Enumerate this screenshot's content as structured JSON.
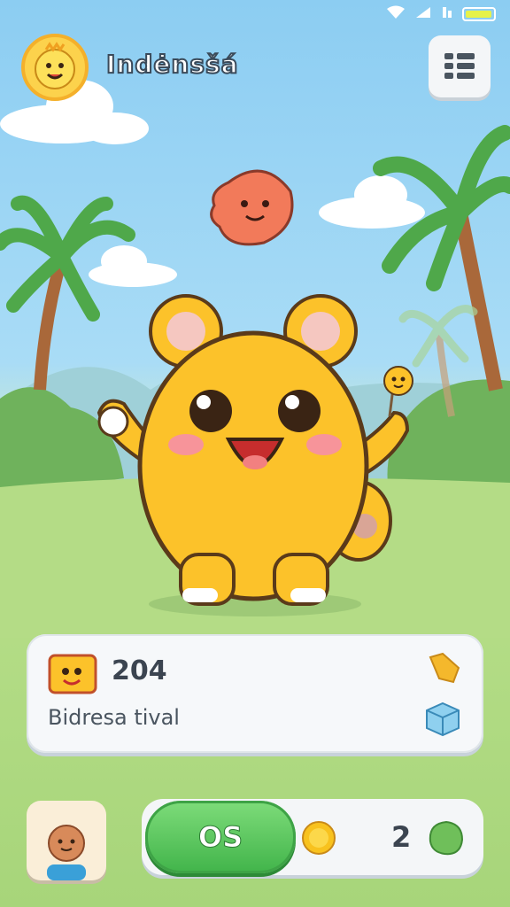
{
  "header": {
    "title": "Indėnsšá",
    "avatar_icon": "smiley-sun-icon",
    "menu_icon": "grid-menu-icon"
  },
  "status_bar": {
    "wifi_icon": "wifi-icon",
    "signal_icon": "signal-icon",
    "battery_icon": "battery-icon",
    "battery_level": 0.85
  },
  "scene": {
    "main_character": "yellow-bear-character",
    "floating_character": "red-blob-character",
    "held_item": "mini-yellow-friend-icon"
  },
  "card": {
    "score": "204",
    "subtitle": "Bidresa tival",
    "badge_icon": "yellow-monster-badge-icon",
    "action_icon": "yellow-puzzle-icon",
    "box_icon": "blue-cube-icon"
  },
  "bottom_bar": {
    "button_label": "OS",
    "coin_icon": "gold-coin-icon",
    "count": "2",
    "leaf_icon": "green-leaf-icon",
    "profile_icon": "kid-avatar-icon"
  },
  "colors": {
    "sky": "#8ccdf2",
    "grass": "#a7d57a",
    "character": "#fcc22a",
    "button_green": "#41b44a"
  }
}
